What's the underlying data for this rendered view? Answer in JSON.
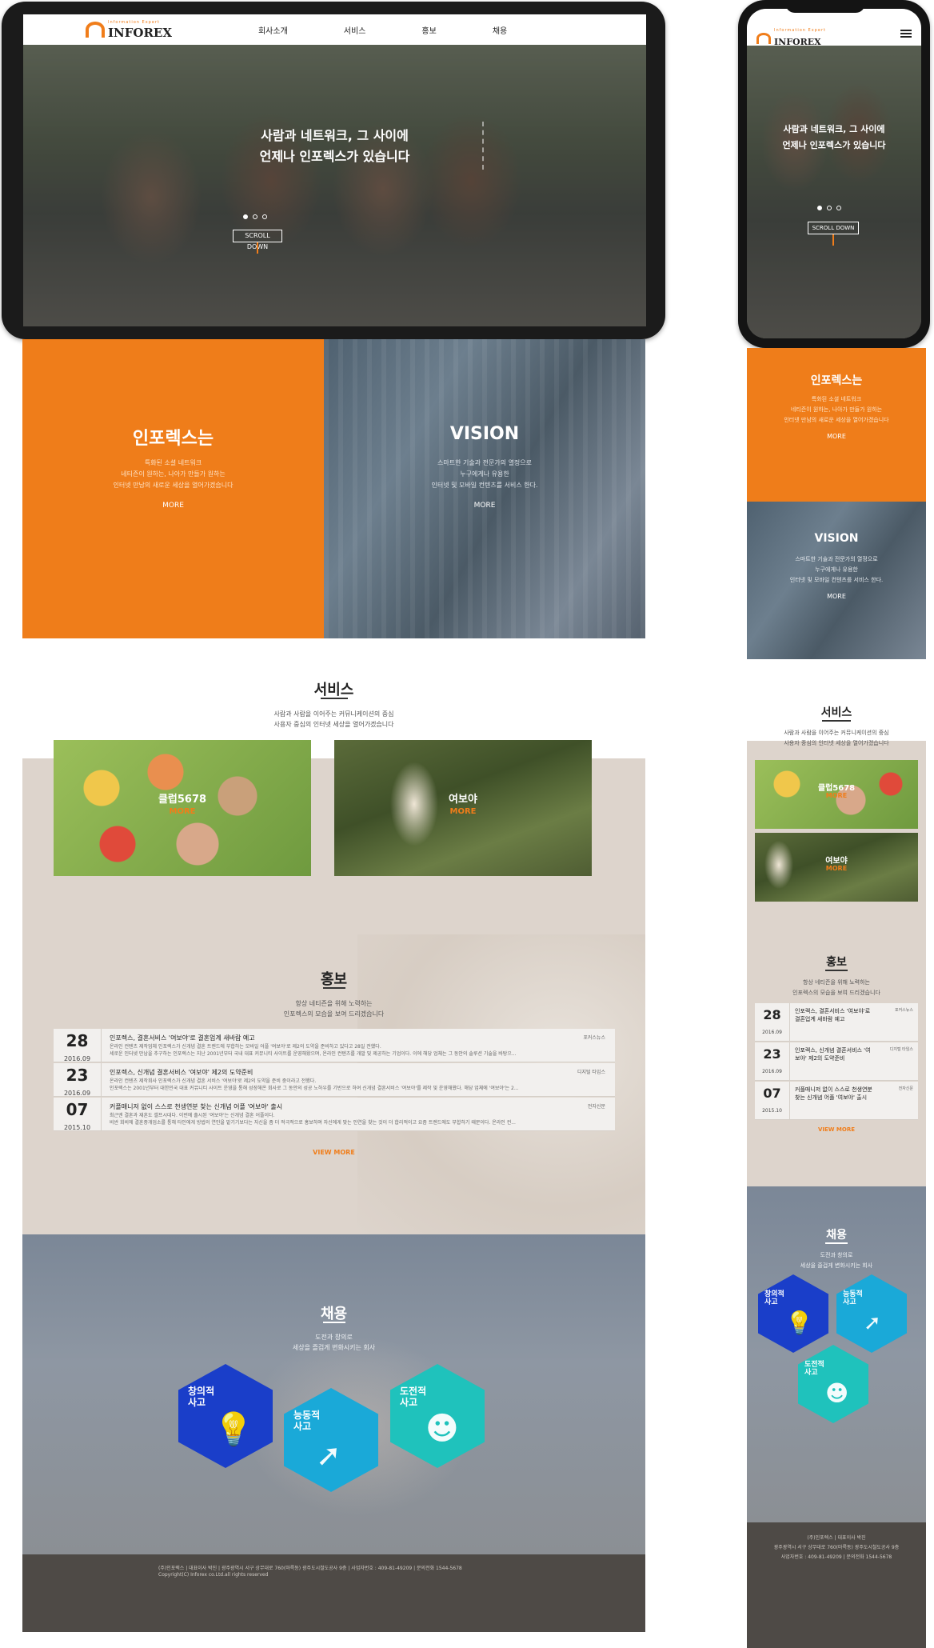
{
  "brand": {
    "logo_text": "INFOREX",
    "logo_sub": "Information Expert"
  },
  "nav": {
    "items": [
      "회사소개",
      "서비스",
      "홍보",
      "채용"
    ]
  },
  "hero": {
    "line1": "사람과 네트워크, 그 사이에",
    "line2": "언제나 인포렉스가 있습니다",
    "scroll_label": "SCROLL DOWN",
    "slides": 3,
    "active_slide": 1
  },
  "about": {
    "title": "인포렉스는",
    "lines": [
      "특화된 소셜 네트워크",
      "네티즌이 원하는, 나아가 만들가 원하는",
      "인터넷 만남의 새로운 세상을 열어가겠습니다"
    ],
    "more": "MORE"
  },
  "vision": {
    "title": "VISION",
    "lines": [
      "스마트한 기술과 전문가의 열정으로",
      "누구에게나 유용한",
      "인터넷 및 모바일 컨텐츠를 서비스 한다."
    ],
    "more": "MORE"
  },
  "services": {
    "title": "서비스",
    "desc1": "사람과 사람을 이어주는 커뮤니케이션의 중심",
    "desc2": "사용자 중심의 인터넷 세상을 열어가겠습니다",
    "cards": [
      {
        "label": "클럽5678",
        "more": "MORE"
      },
      {
        "label": "여보야",
        "more": "MORE"
      }
    ]
  },
  "pr": {
    "title": "홍보",
    "desc1": "항상 네티즌을 위해 노력하는",
    "desc2": "인포렉스의 모습을 보여 드리겠습니다",
    "news": [
      {
        "day": "28",
        "ym": "2016.09",
        "title": "인포렉스, 결혼서비스 '여보야'로 결혼업계 새바람 예고",
        "source": "포커스뉴스",
        "content": "온라인 컨텐츠 제작업체 인포렉스가 신개념 결혼 트렌드에 부합하는 모바일 어플 '여보야'로 제2의 도약을 준비하고 있다고 28일 전했다.",
        "content2": "세로운 인터넷 만남을 추구하는 인포렉스는 지난 2001년부터 국내 대표 커뮤니티 사이트를 운영해왔으며, 온라인 컨텐츠를 개발 및 제공하는 기업이다. 이에 해당 업체는 그 동안의 솔루션 기술을 바탕으..."
      },
      {
        "day": "23",
        "ym": "2016.09",
        "title": "인포렉스, 신개념 결혼서비스 '여보야' 제2의 도약준비",
        "source": "디지털 타임스",
        "content": "온라인 컨텐츠 제작회사 인포렉스가 신개념 결혼 서비스 '여보야'로 제2의 도약을 준비 중이라고 전했다.",
        "content2": "인포렉스는 2001년부터 대한민국 대표 커뮤니티 사이트 운영을 통해 성장해온 회사로 그 동안의 성공 노하우를 기반으로 하여 신개념 결혼서비스 '여보야'를 제작 및 운영해왔다. 해당 업체에 '여보야'는 2..."
      },
      {
        "day": "07",
        "ym": "2015.10",
        "title": "커플매니저 없이 스스로 천생연분 찾는 신개념 어플 '여보야' 출시",
        "source": "전자신문",
        "content": "최근엔 결혼과 재혼도 셀프시대다. 이번에 출시된 '여보야'는 신개념 결혼 어플이다.",
        "content2": "비싼 회비에 결혼중개업소를 통해 타인에게 방법의 연인을 맡기기보다는 자신을 좀 더 적극적으로 홍보하며 자신에게 맞는 인연을 찾는 것이 더 합리적이고 요즘 트렌드에도 부합하기 때문이다. 온라인 컨..."
      }
    ],
    "mobile_titles": [
      "인포렉스, 결혼서비스 '여보야'로 결혼업계 새바람 예고",
      "인포렉스, 신개념 결혼서비스 '여보야' 제2의 도약준비",
      "커플매니저 없이 스스로 천생연분 찾는 신개념 어플 '여보야' 출시"
    ],
    "view_more": "VIEW MORE"
  },
  "recruit": {
    "title": "채용",
    "desc1": "도전과 창의로",
    "desc2": "세상을 즐겁게 변화시키는 회사",
    "hexes": [
      {
        "label1": "창의적",
        "label2": "사고",
        "color": "#1a3ec9",
        "icon": "lightbulb-head-icon"
      },
      {
        "label1": "능동적",
        "label2": "사고",
        "color": "#1aa9d8",
        "icon": "running-arrow-icon"
      },
      {
        "label1": "도전적",
        "label2": "사고",
        "color": "#1fc2bc",
        "icon": "headband-person-icon"
      }
    ]
  },
  "footer": {
    "line1": "(주)인포렉스  |  대표이사 박진  |  광주광역시 서구 상무대로 760(마륵동) 광주도시철도공사 9층  |  사업자번호 : 409-81-49209  |  문의전화 1544-5678",
    "line2": "Copyright(C) Inforex co.Ltd.all rights reserved",
    "m_line1": "(주)인포렉스  |  대표이사 박진",
    "m_line2": "광주광역시 서구 상무대로 760(마륵동) 광주도시철도공사 9층",
    "m_line3": "사업자번호 : 409-81-49209  |  문의전화 1544-5678"
  },
  "colors": {
    "accent": "#ef7d1a",
    "footer": "#4e4a46",
    "band": "#ddd4cc"
  }
}
